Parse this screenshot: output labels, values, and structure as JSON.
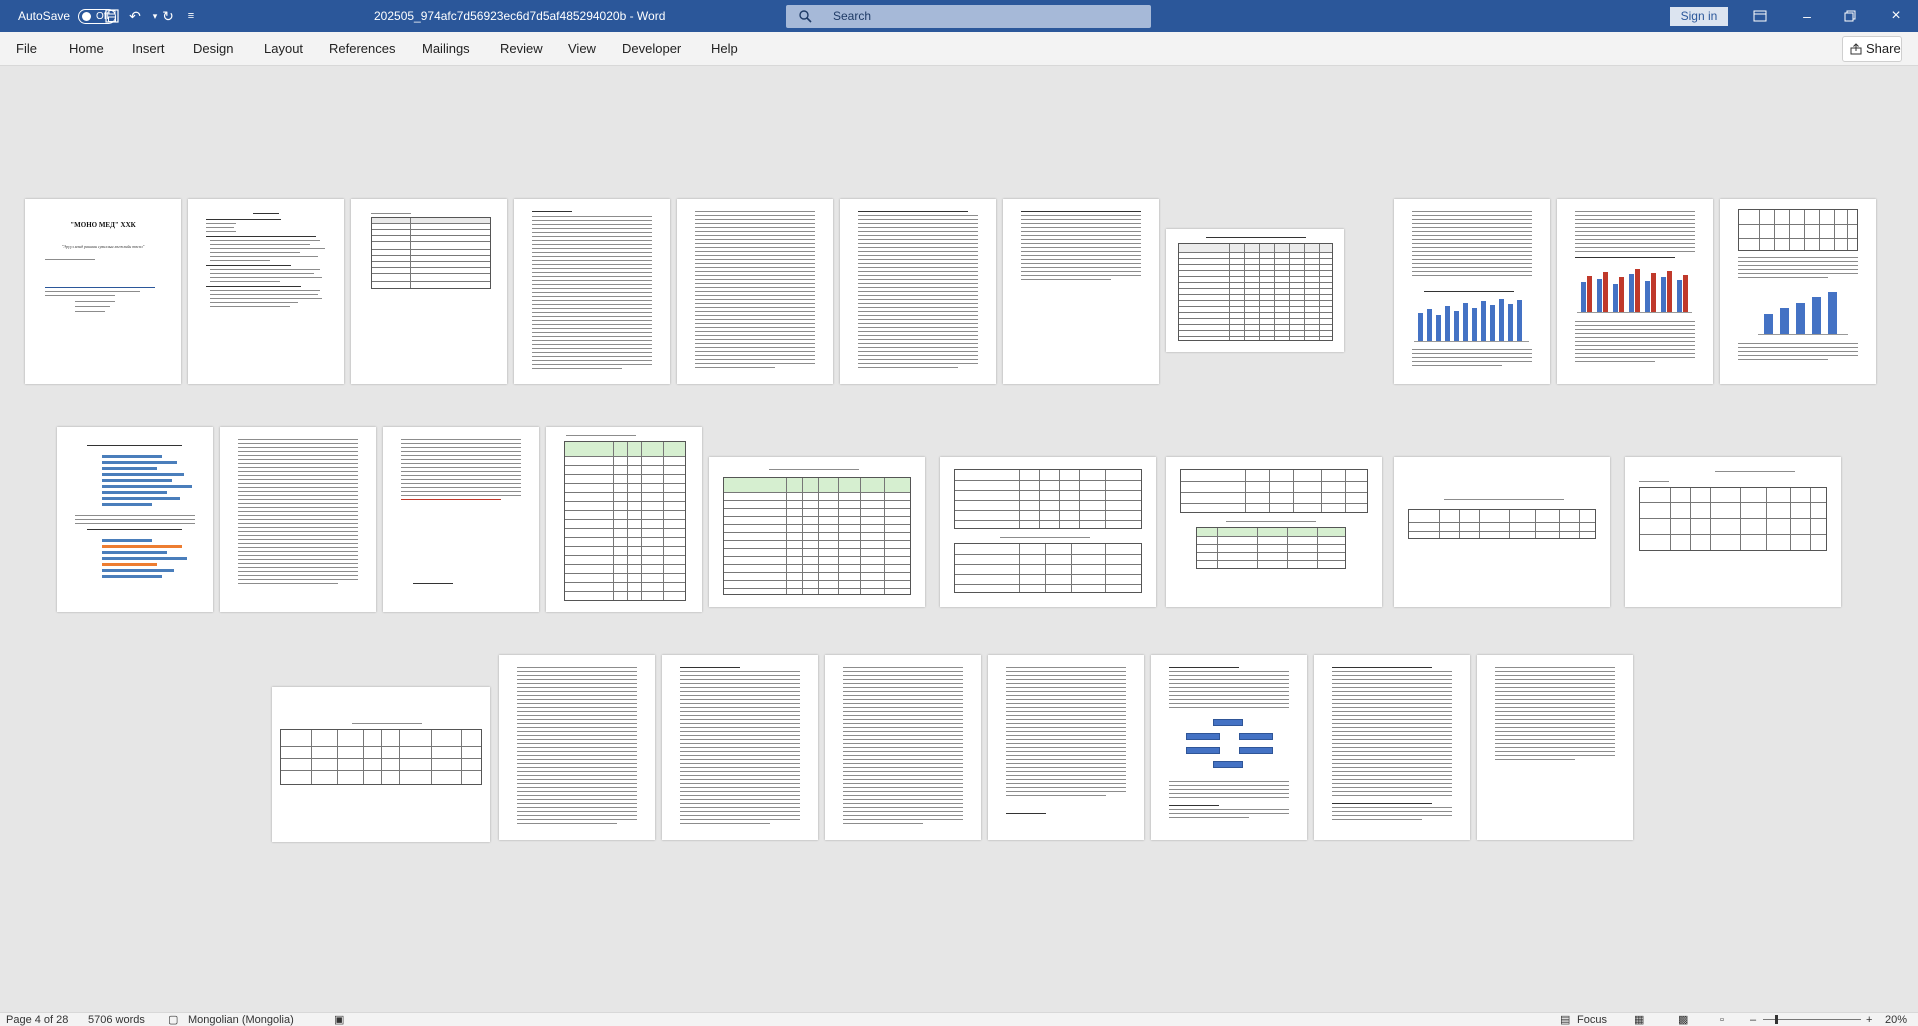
{
  "titlebar": {
    "autosave_label": "AutoSave",
    "autosave_state": "Off",
    "document_title": "202505_974afc7d56923ec6d7d5af485294020b  -  Word",
    "search_placeholder": "Search",
    "signin_label": "Sign in"
  },
  "menu": {
    "items": [
      "File",
      "Home",
      "Insert",
      "Design",
      "Layout",
      "References",
      "Mailings",
      "Review",
      "View",
      "Developer",
      "Help"
    ],
    "share_label": "Share"
  },
  "page1": {
    "title": "\"МОНО МЕД\" ХХК",
    "subtitle": "\"Эрүүл мэнд рашаан сувиллын хөгжлийн төсөл\""
  },
  "statusbar": {
    "page_info": "Page 4 of 28",
    "words": "5706 words",
    "language": "Mongolian (Mongolia)",
    "focus_label": "Focus",
    "zoom": "20%"
  },
  "colors": {
    "titlebar_bg": "#2b579a",
    "chart_blue": "#4472c4",
    "chart_red": "#c0392b",
    "table_header_green": "#d6efd0"
  }
}
